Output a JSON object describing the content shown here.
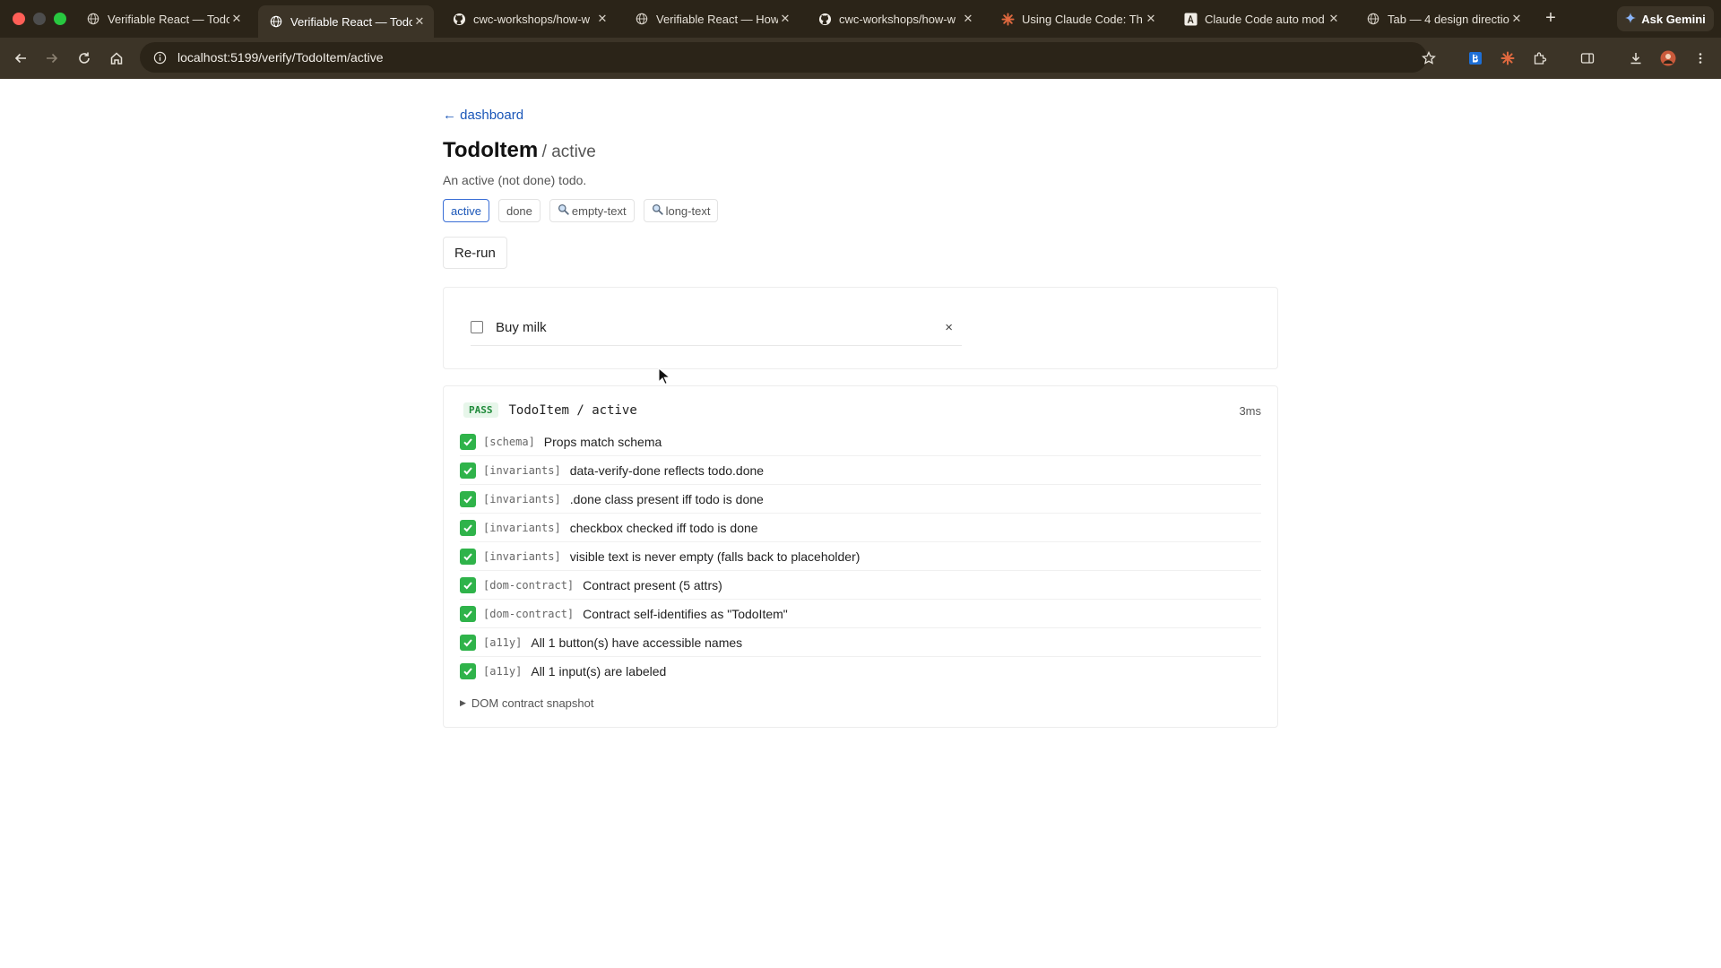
{
  "browser": {
    "tabs": [
      {
        "title": "Verifiable React — Todo",
        "favicon": "globe-icon",
        "active": false
      },
      {
        "title": "Verifiable React — Todo",
        "favicon": "globe-icon",
        "active": true
      },
      {
        "title": "cwc-workshops/how-w",
        "favicon": "github-icon",
        "active": false
      },
      {
        "title": "Verifiable React — How",
        "favicon": "globe-icon",
        "active": false
      },
      {
        "title": "cwc-workshops/how-w",
        "favicon": "github-icon",
        "active": false
      },
      {
        "title": "Using Claude Code: Th",
        "favicon": "claude-icon",
        "active": false
      },
      {
        "title": "Claude Code auto mod",
        "favicon": "anthropic-icon",
        "active": false
      },
      {
        "title": "Tab — 4 design directio",
        "favicon": "globe-icon",
        "active": false
      }
    ],
    "gemini_label": "Ask Gemini",
    "url": "localhost:5199/verify/TodoItem/active"
  },
  "page": {
    "back_link": "← dashboard",
    "title": "TodoItem",
    "variant": "/ active",
    "description": "An active (not done) todo.",
    "variants": [
      {
        "label": "active",
        "active": true,
        "icon": ""
      },
      {
        "label": "done",
        "active": false,
        "icon": ""
      },
      {
        "label": "empty-text",
        "active": false,
        "icon": "magnifier-icon"
      },
      {
        "label": "long-text",
        "active": false,
        "icon": "magnifier-icon"
      }
    ],
    "rerun_label": "Re-run"
  },
  "preview": {
    "todo_text": "Buy milk",
    "delete_glyph": "×",
    "checked": false
  },
  "results": {
    "status": "PASS",
    "title": "TodoItem / active",
    "duration": "3ms",
    "checks": [
      {
        "category": "[schema]",
        "message": "Props match schema"
      },
      {
        "category": "[invariants]",
        "message": "data-verify-done reflects todo.done"
      },
      {
        "category": "[invariants]",
        "message": ".done class present iff todo is done"
      },
      {
        "category": "[invariants]",
        "message": "checkbox checked iff todo is done"
      },
      {
        "category": "[invariants]",
        "message": "visible text is never empty (falls back to placeholder)"
      },
      {
        "category": "[dom-contract]",
        "message": "Contract present (5 attrs)"
      },
      {
        "category": "[dom-contract]",
        "message": "Contract self-identifies as \"TodoItem\""
      },
      {
        "category": "[a11y]",
        "message": "All 1 button(s) have accessible names"
      },
      {
        "category": "[a11y]",
        "message": "All 1 input(s) are labeled"
      }
    ],
    "snapshot_label": "DOM contract snapshot"
  },
  "colors": {
    "link": "#1a56b8",
    "pass": "#1f8a3a",
    "check_ok": "#2fb34a",
    "chrome_bg": "#2b2418"
  }
}
